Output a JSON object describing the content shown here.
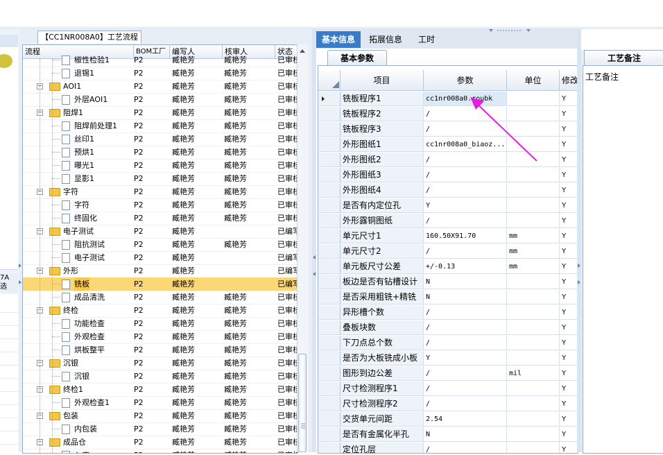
{
  "left_stub": {
    "label": "7A\n选"
  },
  "flow_panel": {
    "title": "【CC1NR008A0】工艺流程",
    "columns": [
      "流程",
      "BOM工厂",
      "编写人",
      "核审人",
      "状态"
    ],
    "rows": [
      {
        "level": 2,
        "type": "doc",
        "name": "椒性检验1",
        "bom": "P2",
        "writer": "臧艳芳",
        "reviewer": "臧艳芳",
        "status": "已审核",
        "selected": false
      },
      {
        "level": 2,
        "type": "doc",
        "name": "退锡1",
        "bom": "P2",
        "writer": "臧艳芳",
        "reviewer": "臧艳芳",
        "status": "已审核",
        "selected": false
      },
      {
        "level": 1,
        "type": "folder",
        "name": "AOI1",
        "bom": "P2",
        "writer": "臧艳芳",
        "reviewer": "臧艳芳",
        "status": "已审核",
        "selected": false
      },
      {
        "level": 2,
        "type": "doc",
        "name": "外层AOI1",
        "bom": "P2",
        "writer": "臧艳芳",
        "reviewer": "臧艳芳",
        "status": "已审核",
        "selected": false
      },
      {
        "level": 1,
        "type": "folder",
        "name": "阻焊1",
        "bom": "P2",
        "writer": "臧艳芳",
        "reviewer": "臧艳芳",
        "status": "已审核",
        "selected": false
      },
      {
        "level": 2,
        "type": "doc",
        "name": "阻焊前处理1",
        "bom": "P2",
        "writer": "臧艳芳",
        "reviewer": "臧艳芳",
        "status": "已审核",
        "selected": false
      },
      {
        "level": 2,
        "type": "doc",
        "name": "丝印1",
        "bom": "P2",
        "writer": "臧艳芳",
        "reviewer": "臧艳芳",
        "status": "已审核",
        "selected": false
      },
      {
        "level": 2,
        "type": "doc",
        "name": "预烘1",
        "bom": "P2",
        "writer": "臧艳芳",
        "reviewer": "臧艳芳",
        "status": "已审核",
        "selected": false
      },
      {
        "level": 2,
        "type": "doc",
        "name": "曝光1",
        "bom": "P2",
        "writer": "臧艳芳",
        "reviewer": "臧艳芳",
        "status": "已审核",
        "selected": false
      },
      {
        "level": 2,
        "type": "doc",
        "name": "显影1",
        "bom": "P2",
        "writer": "臧艳芳",
        "reviewer": "臧艳芳",
        "status": "已审核",
        "selected": false
      },
      {
        "level": 1,
        "type": "folder",
        "name": "字符",
        "bom": "P2",
        "writer": "臧艳芳",
        "reviewer": "臧艳芳",
        "status": "已审核",
        "selected": false
      },
      {
        "level": 2,
        "type": "doc",
        "name": "字符",
        "bom": "P2",
        "writer": "臧艳芳",
        "reviewer": "臧艳芳",
        "status": "已审核",
        "selected": false
      },
      {
        "level": 2,
        "type": "doc",
        "name": "终固化",
        "bom": "P2",
        "writer": "臧艳芳",
        "reviewer": "臧艳芳",
        "status": "已审核",
        "selected": false
      },
      {
        "level": 1,
        "type": "folder",
        "name": "电子测试",
        "bom": "P2",
        "writer": "臧艳芳",
        "reviewer": "",
        "status": "已编写",
        "selected": false
      },
      {
        "level": 2,
        "type": "doc",
        "name": "阻抗测试",
        "bom": "P2",
        "writer": "臧艳芳",
        "reviewer": "臧艳芳",
        "status": "已审核",
        "selected": false
      },
      {
        "level": 2,
        "type": "doc",
        "name": "电子测试",
        "bom": "P2",
        "writer": "臧艳芳",
        "reviewer": "",
        "status": "已编写",
        "selected": false
      },
      {
        "level": 1,
        "type": "folder",
        "name": "外形",
        "bom": "P2",
        "writer": "臧艳芳",
        "reviewer": "",
        "status": "已编写",
        "selected": false
      },
      {
        "level": 2,
        "type": "doc",
        "name": "铣板",
        "bom": "P2",
        "writer": "臧艳芳",
        "reviewer": "",
        "status": "已编写",
        "selected": true
      },
      {
        "level": 2,
        "type": "doc",
        "name": "成品清洗",
        "bom": "P2",
        "writer": "臧艳芳",
        "reviewer": "臧艳芳",
        "status": "已审核",
        "selected": false
      },
      {
        "level": 1,
        "type": "folder",
        "name": "终检",
        "bom": "P2",
        "writer": "臧艳芳",
        "reviewer": "臧艳芳",
        "status": "已审核",
        "selected": false
      },
      {
        "level": 2,
        "type": "doc",
        "name": "功能检查",
        "bom": "P2",
        "writer": "臧艳芳",
        "reviewer": "臧艳芳",
        "status": "已审核",
        "selected": false
      },
      {
        "level": 2,
        "type": "doc",
        "name": "外观检查",
        "bom": "P2",
        "writer": "臧艳芳",
        "reviewer": "臧艳芳",
        "status": "已审核",
        "selected": false
      },
      {
        "level": 2,
        "type": "doc",
        "name": "烘板整平",
        "bom": "P2",
        "writer": "臧艳芳",
        "reviewer": "臧艳芳",
        "status": "已审核",
        "selected": false
      },
      {
        "level": 1,
        "type": "folder",
        "name": "沉银",
        "bom": "P2",
        "writer": "臧艳芳",
        "reviewer": "臧艳芳",
        "status": "已审核",
        "selected": false
      },
      {
        "level": 2,
        "type": "doc",
        "name": "沉银",
        "bom": "P2",
        "writer": "臧艳芳",
        "reviewer": "臧艳芳",
        "status": "已审核",
        "selected": false
      },
      {
        "level": 1,
        "type": "folder",
        "name": "终检1",
        "bom": "P2",
        "writer": "臧艳芳",
        "reviewer": "臧艳芳",
        "status": "已审核",
        "selected": false
      },
      {
        "level": 2,
        "type": "doc",
        "name": "外观检查1",
        "bom": "P2",
        "writer": "臧艳芳",
        "reviewer": "臧艳芳",
        "status": "已审核",
        "selected": false
      },
      {
        "level": 1,
        "type": "folder",
        "name": "包装",
        "bom": "P2",
        "writer": "臧艳芳",
        "reviewer": "臧艳芳",
        "status": "已审核",
        "selected": false
      },
      {
        "level": 2,
        "type": "doc",
        "name": "内包装",
        "bom": "P2",
        "writer": "臧艳芳",
        "reviewer": "臧艳芳",
        "status": "已审核",
        "selected": false
      },
      {
        "level": 1,
        "type": "folder",
        "name": "成品仓",
        "bom": "P2",
        "writer": "臧艳芳",
        "reviewer": "臧艳芳",
        "status": "已审核",
        "selected": false
      },
      {
        "level": 2,
        "type": "doc",
        "name": "入库",
        "bom": "P2",
        "writer": "臧艳芳",
        "reviewer": "臧艳芳",
        "status": "已审核",
        "selected": false
      }
    ]
  },
  "main_tabs": {
    "basic": "基本信息",
    "extended": "拓展信息",
    "hours": "工时"
  },
  "basic_params": {
    "subtab": "基本参数",
    "columns": {
      "item": "项目",
      "param": "参数",
      "unit": "单位",
      "modify": "修改"
    },
    "rows": [
      {
        "item": "铣板程序1",
        "param": "cc1nr008a0.roubk",
        "unit": "",
        "mod": "Y"
      },
      {
        "item": "铣板程序2",
        "param": "/",
        "unit": "",
        "mod": "Y"
      },
      {
        "item": "铣板程序3",
        "param": "/",
        "unit": "",
        "mod": "Y"
      },
      {
        "item": "外形图纸1",
        "param": "cc1nr008a0_biaoz...",
        "unit": "",
        "mod": "Y"
      },
      {
        "item": "外形图纸2",
        "param": "/",
        "unit": "",
        "mod": "Y"
      },
      {
        "item": "外形图纸3",
        "param": "/",
        "unit": "",
        "mod": "Y"
      },
      {
        "item": "外形图纸4",
        "param": "/",
        "unit": "",
        "mod": "Y"
      },
      {
        "item": "是否有内定位孔",
        "param": "Y",
        "unit": "",
        "mod": "Y"
      },
      {
        "item": "外形露铜图纸",
        "param": "/",
        "unit": "",
        "mod": "Y"
      },
      {
        "item": "单元尺寸1",
        "param": "160.50X91.70",
        "unit": "mm",
        "mod": "Y"
      },
      {
        "item": "单元尺寸2",
        "param": "/",
        "unit": "mm",
        "mod": "Y"
      },
      {
        "item": "单元板尺寸公差",
        "param": "+/-0.13",
        "unit": "mm",
        "mod": "Y"
      },
      {
        "item": "板边是否有钻槽设计",
        "param": "N",
        "unit": "",
        "mod": "Y"
      },
      {
        "item": "是否采用粗铣+精铣",
        "param": "N",
        "unit": "",
        "mod": "Y"
      },
      {
        "item": "异形槽个数",
        "param": "/",
        "unit": "",
        "mod": "Y"
      },
      {
        "item": "叠板块数",
        "param": "/",
        "unit": "",
        "mod": "Y"
      },
      {
        "item": "下刀点总个数",
        "param": "/",
        "unit": "",
        "mod": "Y"
      },
      {
        "item": "是否为大板铣成小板",
        "param": "Y",
        "unit": "",
        "mod": "Y"
      },
      {
        "item": "图形到边公差",
        "param": "/",
        "unit": "mil",
        "mod": "Y"
      },
      {
        "item": "尺寸检测程序1",
        "param": "/",
        "unit": "",
        "mod": "Y"
      },
      {
        "item": "尺寸检测程序2",
        "param": "/",
        "unit": "",
        "mod": "Y"
      },
      {
        "item": "交货单元间距",
        "param": "2.54",
        "unit": "",
        "mod": "Y"
      },
      {
        "item": "是否有金属化半孔",
        "param": "N",
        "unit": "",
        "mod": "Y"
      },
      {
        "item": "定位孔层",
        "param": "/",
        "unit": "",
        "mod": "Y"
      }
    ]
  },
  "remarks": {
    "tab": "工艺备注",
    "label": "工艺备注"
  },
  "colors": {
    "accent": "#3a7bc8",
    "selected_row": "#fbd776",
    "arrow": "#e81ce0",
    "folder": "#f2c649"
  }
}
